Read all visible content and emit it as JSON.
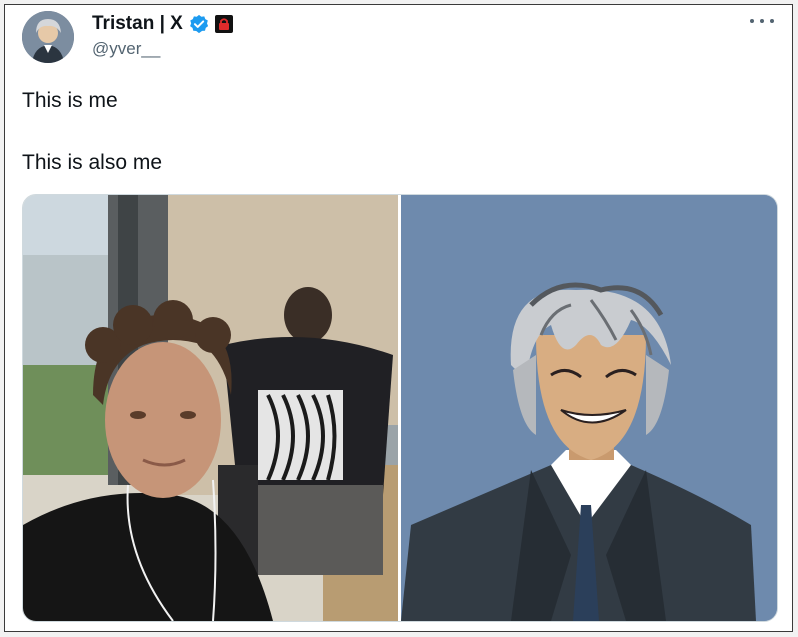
{
  "tweet": {
    "author_name": "Tristan | X",
    "handle": "@yver__",
    "text_line1": "This is me",
    "text_line2": "This is also me",
    "icons": {
      "verified": "verified-badge-icon",
      "lock": "lock-badge-icon",
      "more": "more-icon"
    },
    "colors": {
      "verified_blue": "#1d9bf0",
      "lock_red": "#e02b2b",
      "text": "#0f1419",
      "muted": "#536471"
    }
  },
  "media": {
    "images": [
      {
        "label": "photo-selfie"
      },
      {
        "label": "illustration-anime-portrait"
      }
    ]
  }
}
